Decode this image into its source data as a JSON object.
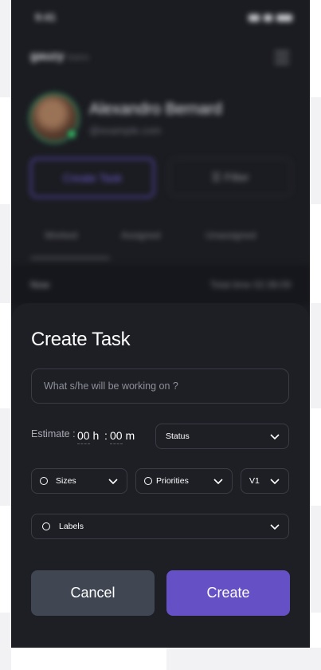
{
  "status_bar": {
    "time": "9:41"
  },
  "header": {
    "logo": "gauzy",
    "logo_suffix": "teams"
  },
  "profile": {
    "name": "Alexandro Bernard",
    "email": "@example.com"
  },
  "actions": {
    "create_task": "Create Task",
    "filter": "Filter"
  },
  "tabs": [
    {
      "label": "Worked"
    },
    {
      "label": "Assigned"
    },
    {
      "label": "Unassigned"
    }
  ],
  "list_header": {
    "left": "Now",
    "right": "Total time 02:38:09"
  },
  "sheet": {
    "title": "Create Task",
    "task_input": {
      "placeholder": "What s/he will be working on ?",
      "value": ""
    },
    "estimate": {
      "label": "Estimate :",
      "hours": "00",
      "hours_unit": "h",
      "separator": ":",
      "minutes": "00",
      "minutes_unit": "m"
    },
    "status_select": {
      "label": "Status"
    },
    "sizes_select": {
      "label": "Sizes"
    },
    "priorities_select": {
      "label": "Priorities"
    },
    "version_select": {
      "label": "V1"
    },
    "labels_select": {
      "label": "Labels"
    },
    "cancel_label": "Cancel",
    "create_label": "Create"
  },
  "colors": {
    "accent": "#6650c6",
    "sheet_bg": "#1e1f25",
    "cancel_bg": "#404752"
  }
}
